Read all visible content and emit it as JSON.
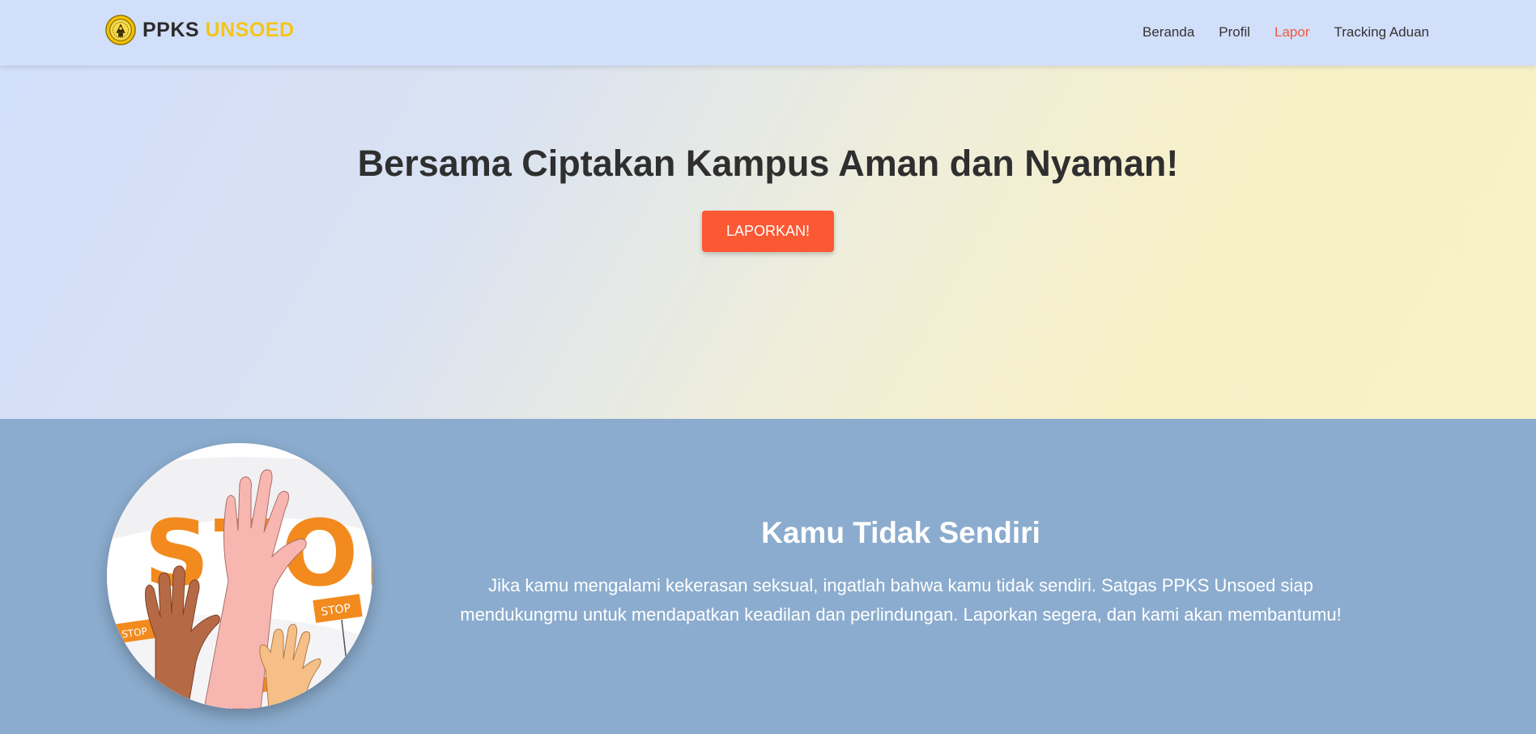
{
  "brand": {
    "name_part1": "PPKS",
    "name_part2": "UNSOED",
    "logo_icon": "unsoed-seal-logo"
  },
  "nav": {
    "items": [
      {
        "label": "Beranda",
        "active": false
      },
      {
        "label": "Profil",
        "active": false
      },
      {
        "label": "Lapor",
        "active": true
      },
      {
        "label": "Tracking Aduan",
        "active": false
      }
    ]
  },
  "hero": {
    "title": "Bersama Ciptakan Kampus Aman dan Nyaman!",
    "cta_label": "LAPORKAN!"
  },
  "support": {
    "image_sign_text": "STOP",
    "title": "Kamu Tidak Sendiri",
    "body": "Jika kamu mengalami kekerasan seksual, ingatlah bahwa kamu tidak sendiri. Satgas PPKS Unsoed siap mendukungmu untuk mendapatkan keadilan dan perlindungan. Laporkan segera, dan kami akan membantumu!"
  },
  "colors": {
    "navbar_bg": "#d2dffa",
    "brand_accent": "#f5c518",
    "active_link": "#ef5a3c",
    "cta": "#fb5834",
    "section_bg": "#8bacce"
  }
}
